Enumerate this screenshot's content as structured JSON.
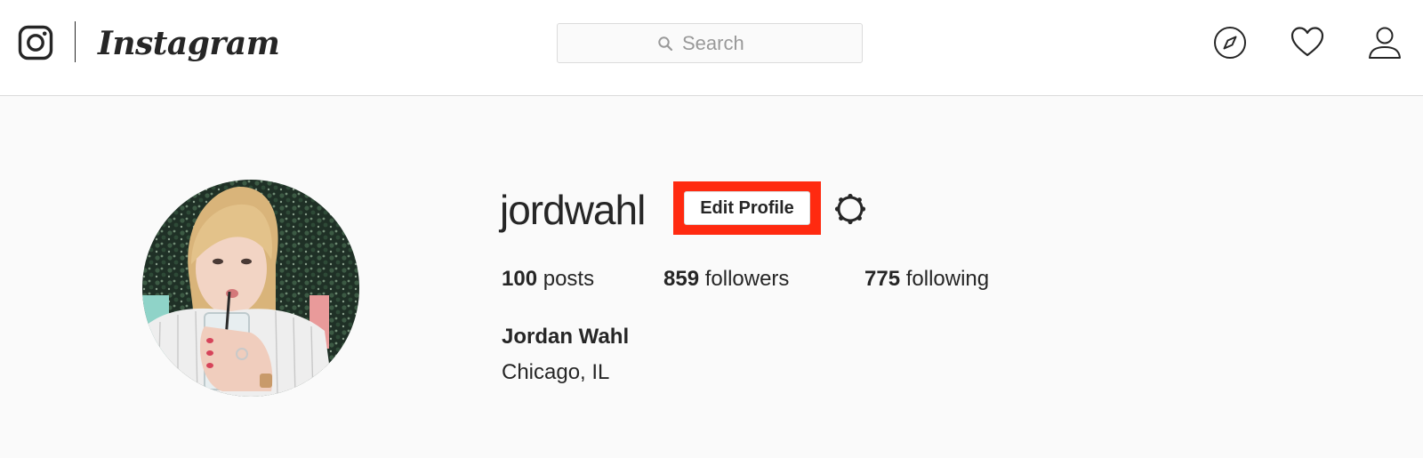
{
  "header": {
    "brand": "Instagram",
    "search": {
      "placeholder": "Search",
      "value": ""
    },
    "icons": [
      "instagram-glyph-icon",
      "explore-compass-icon",
      "activity-heart-icon",
      "profile-person-icon"
    ]
  },
  "profile": {
    "username": "jordwahl",
    "edit_label": "Edit Profile",
    "highlight_color": "#ff2a10",
    "stats": {
      "posts_count": "100",
      "posts_label": "posts",
      "followers_count": "859",
      "followers_label": "followers",
      "following_count": "775",
      "following_label": "following"
    },
    "full_name": "Jordan Wahl",
    "location": "Chicago, IL"
  },
  "colors": {
    "text": "#262626",
    "border": "#dbdbdb",
    "page_background": "#fafafa",
    "header_background": "#ffffff"
  }
}
